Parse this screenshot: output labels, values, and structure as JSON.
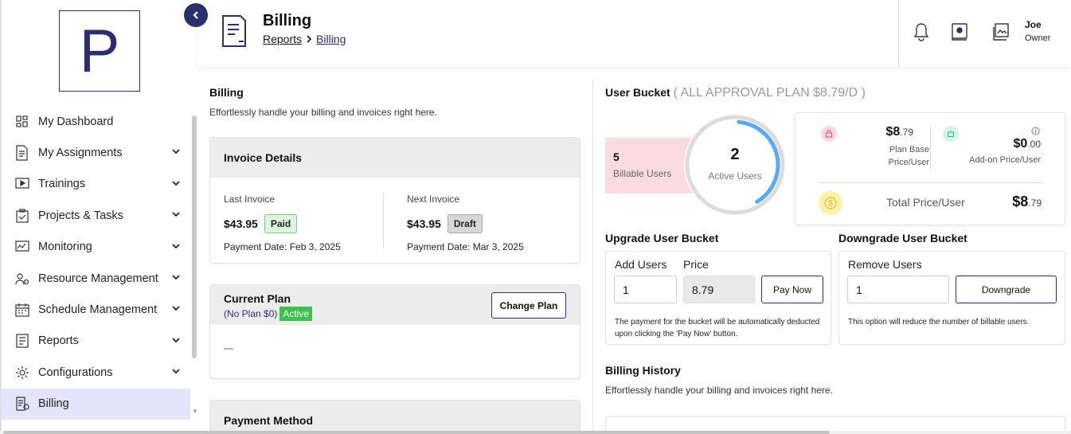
{
  "sidebar": {
    "logo_letter": "P",
    "items": [
      {
        "label": "My Dashboard",
        "icon": "dashboard-icon",
        "has_chevron": false
      },
      {
        "label": "My Assignments",
        "icon": "assignments-icon",
        "has_chevron": true
      },
      {
        "label": "Trainings",
        "icon": "play-icon",
        "has_chevron": true
      },
      {
        "label": "Projects & Tasks",
        "icon": "clipboard-icon",
        "has_chevron": true
      },
      {
        "label": "Monitoring",
        "icon": "monitor-icon",
        "has_chevron": true
      },
      {
        "label": "Resource Management",
        "icon": "users-gear-icon",
        "has_chevron": true
      },
      {
        "label": "Schedule Management",
        "icon": "calendar-icon",
        "has_chevron": true
      },
      {
        "label": "Reports",
        "icon": "report-icon",
        "has_chevron": true
      },
      {
        "label": "Configurations",
        "icon": "gear-icon",
        "has_chevron": true
      },
      {
        "label": "Billing",
        "icon": "billing-icon",
        "has_chevron": false,
        "active": true
      }
    ]
  },
  "header": {
    "title": "Billing",
    "breadcrumb": [
      "Reports",
      "Billing"
    ],
    "user": {
      "name": "Joe",
      "role": "Owner"
    }
  },
  "billing": {
    "title": "Billing",
    "subtitle": "Effortlessly handle your billing and invoices right here."
  },
  "invoice": {
    "title": "Invoice Details",
    "last": {
      "label": "Last Invoice",
      "amount": "$43.95",
      "status": "Paid",
      "date": "Payment Date: Feb 3, 2025"
    },
    "next": {
      "label": "Next Invoice",
      "amount": "$43.95",
      "status": "Draft",
      "date": "Payment Date: Mar 3, 2025"
    }
  },
  "plan": {
    "title": "Current Plan",
    "subtitle": "(No Plan $0)",
    "status": "Active",
    "change_label": "Change Plan",
    "body": "---"
  },
  "payment_method": {
    "title": "Payment Method"
  },
  "bucket": {
    "title": "User Bucket",
    "plan_label": "( ALL APPROVAL PLAN $8.79/D )",
    "billable_users": "5",
    "billable_label": "Billable Users",
    "active_users": "2",
    "active_label": "Active Users",
    "active_fraction": 0.4,
    "base_price_int": "$8",
    "base_price_dec": ".79",
    "base_label_1": "Plan Base",
    "base_label_2": "Price/User",
    "addon_price_int": "$0",
    "addon_price_dec": ".00",
    "addon_label": "Add-on Price/User",
    "total_label": "Total Price/User",
    "total_int": "$8",
    "total_dec": ".79"
  },
  "upgrade": {
    "title": "Upgrade User Bucket",
    "add_label": "Add Users",
    "price_label": "Price",
    "add_value": "1",
    "price_value": "8.79",
    "pay_label": "Pay Now",
    "note": "The payment for the bucket will be automatically deducted upon clicking the 'Pay Now' button."
  },
  "downgrade": {
    "title": "Downgrade User Bucket",
    "remove_label": "Remove Users",
    "remove_value": "1",
    "btn_label": "Downgrade",
    "note": "This option will reduce the number of billable users."
  },
  "history": {
    "title": "Billing History",
    "subtitle": "Effortlessly handle your billing and invoices right here."
  },
  "colors": {
    "brand": "#2b2f6e",
    "active_nav": "#e6e4fb",
    "ring": "#5aa9f5",
    "billable_bg": "#fadbe2"
  }
}
